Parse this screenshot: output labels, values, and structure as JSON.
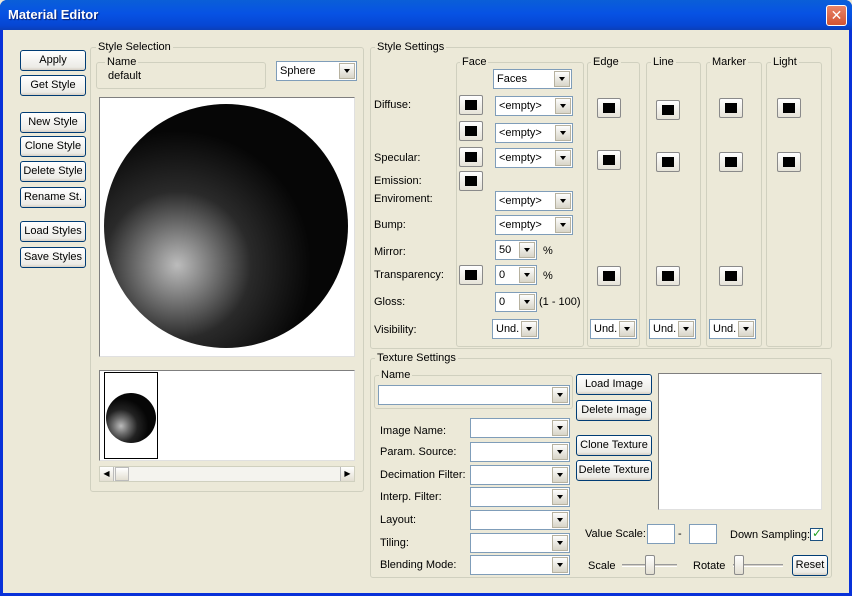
{
  "window": {
    "title": "Material Editor"
  },
  "left_buttons": [
    "Apply",
    "Get Style",
    "New Style",
    "Clone Style",
    "Delete Style",
    "Rename St.",
    "Load Styles",
    "Save Styles"
  ],
  "style_selection": {
    "title": "Style Selection",
    "name_label": "Name",
    "name_value": "default",
    "preview_shape": "Sphere"
  },
  "style_settings": {
    "title": "Style Settings",
    "columns": {
      "face": "Face",
      "edge": "Edge",
      "line": "Line",
      "marker": "Marker",
      "light": "Light"
    },
    "face_mode": "Faces",
    "labels": {
      "diffuse": "Diffuse:",
      "specular": "Specular:",
      "emission": "Emission:",
      "environment": "Enviroment:",
      "bump": "Bump:",
      "mirror": "Mirror:",
      "transparency": "Transparency:",
      "gloss": "Gloss:",
      "visibility": "Visibility:"
    },
    "values": {
      "diffuse_tex1": "<empty>",
      "diffuse_tex2": "<empty>",
      "specular_tex": "<empty>",
      "environment_tex": "<empty>",
      "bump_tex": "<empty>",
      "mirror": "50",
      "mirror_unit": "%",
      "transparency": "0",
      "transparency_unit": "%",
      "gloss": "0",
      "gloss_range": "(1 - 100)",
      "visibility_face": "Und.",
      "visibility_edge": "Und.",
      "visibility_line": "Und.",
      "visibility_marker": "Und."
    }
  },
  "texture_settings": {
    "title": "Texture Settings",
    "name_label": "Name",
    "name_value": "",
    "buttons": {
      "load_image": "Load Image",
      "delete_image": "Delete Image",
      "clone_texture": "Clone Texture",
      "delete_texture": "Delete Texture",
      "reset": "Reset"
    },
    "fields": [
      "Image Name:",
      "Param. Source:",
      "Decimation Filter:",
      "Interp. Filter:",
      "Layout:",
      "Tiling:",
      "Blending Mode:"
    ],
    "value_scale_label": "Value Scale:",
    "value_scale_sep": "-",
    "value_scale_min": "",
    "value_scale_max": "",
    "down_sampling_label": "Down Sampling:",
    "down_sampling_checked": true,
    "scale_label": "Scale",
    "rotate_label": "Rotate"
  },
  "icons": {
    "close": "close-icon",
    "check": "checkmark-icon",
    "scroll_left": "arrow-left-icon",
    "scroll_right": "arrow-right-icon"
  },
  "colors": {
    "titlebar": "#0752e4",
    "face": "#ece9d8",
    "close": "#d35433"
  }
}
